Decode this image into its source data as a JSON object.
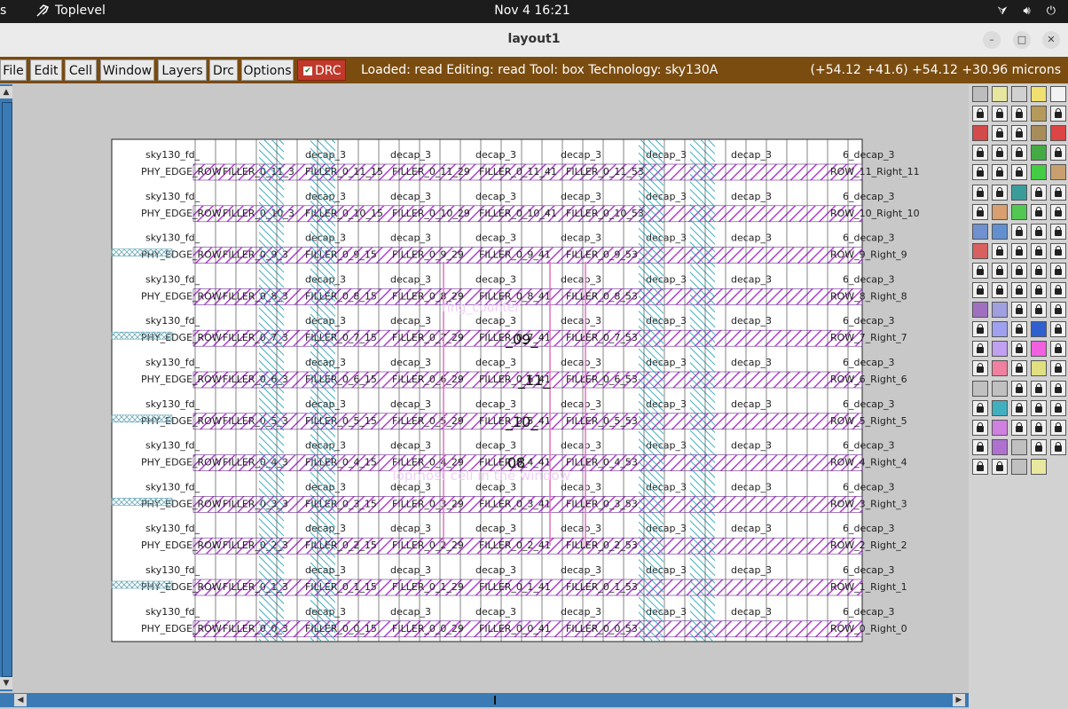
{
  "topbar": {
    "left_fragment": "s",
    "app_name": "Toplevel",
    "clock": "Nov 4  16:21"
  },
  "window": {
    "title": "layout1"
  },
  "menus": [
    "File",
    "Edit",
    "Cell",
    "Window",
    "Layers",
    "Drc",
    "Options"
  ],
  "drc": {
    "label": "DRC",
    "checked": true
  },
  "status": "Loaded: read  Editing: read  Tool: box   Technology: sky130A",
  "coords": "(+54.12 +41.6) +54.12 +30.96 microns",
  "labels": {
    "cell_name": "ring_counter",
    "topmost_message": "Topmost cell in the window",
    "row_prefix": "sky130_fd_",
    "phy_edge": "PHY_EDGE_ROW",
    "decap": "6_decap_3",
    "decap_left": "decap_3",
    "fillers": [
      "FILLER_0_",
      "_15",
      "_29",
      "_41",
      "_53"
    ]
  },
  "rows": [
    {
      "index": "11",
      "right": "ROW_11_Right_11"
    },
    {
      "index": "10",
      "right": "ROW_10_Right_10"
    },
    {
      "index": "9",
      "right": "ROW_9_Right_9"
    },
    {
      "index": "8",
      "right": "ROW_8_Right_8"
    },
    {
      "index": "7",
      "right": "ROW_7_Right_7"
    },
    {
      "index": "6",
      "right": "ROW_6_Right_6"
    },
    {
      "index": "5",
      "right": "ROW_5_Right_5"
    },
    {
      "index": "4",
      "right": "ROW_4_Right_4"
    },
    {
      "index": "3",
      "right": "ROW_3_Right_3"
    },
    {
      "index": "2",
      "right": "ROW_2_Right_2"
    },
    {
      "index": "1",
      "right": "ROW_1_Right_1"
    },
    {
      "index": "0",
      "right": "ROW_0_Right_0"
    }
  ],
  "big_labels": [
    {
      "text": "_09_"
    },
    {
      "text": "_11_"
    },
    {
      "text": "_10_"
    },
    {
      "text": "08"
    }
  ],
  "layer_colors": [
    "#bdbdbd",
    "#e6e6a0",
    "#d0d0d0",
    "#f0e070",
    "#f2f2f2",
    "#f0f0f0",
    "#f0f0f0",
    "#f0f0f0",
    "#b59a5a",
    "#f0f0f0",
    "#d24a4a",
    "#f0f0f0",
    "#f0f0f0",
    "#a88c5a",
    "#d44",
    "#f0f0f0",
    "#f0f0f0",
    "#f0f0f0",
    "#44aa44",
    "#f0f0f0",
    "#f0f0f0",
    "#f0f0f0",
    "#f0f0f0",
    "#44cc44",
    "#c8a070",
    "#f0f0f0",
    "#f0f0f0",
    "#3c9c9c",
    "#f0f0f0",
    "#f0f0f0",
    "#f0f0f0",
    "#d8a070",
    "#52c852",
    "#f0f0f0",
    "#f0f0f0",
    "#7090d0",
    "#6090d0",
    "#f0f0f0",
    "#f0f0f0",
    "#f0f0f0",
    "#d86060",
    "#f0f0f0",
    "#f0f0f0",
    "#f0f0f0",
    "#f0f0f0",
    "#f0f0f0",
    "#f0f0f0",
    "#f0f0f0",
    "#f0f0f0",
    "#f0f0f0",
    "#f0f0f0",
    "#f0f0f0",
    "#f0f0f0",
    "#f0f0f0",
    "#f0f0f0",
    "#a070c0",
    "#a0a0e0",
    "#f0f0f0",
    "#f0f0f0",
    "#f0f0f0",
    "#f0f0f0",
    "#a0a0f0",
    "#f0f0f0",
    "#3060d0",
    "#f0f0f0",
    "#f0f0f0",
    "#c0a0f0",
    "#f0f0f0",
    "#f060e0",
    "#f0f0f0",
    "#f0f0f0",
    "#f080a0",
    "#f0f0f0",
    "#e0e080",
    "#f0f0f0",
    "#c0c0c0",
    "#c0c0c0",
    "#f0f0f0",
    "#f0f0f0",
    "#f0f0f0",
    "#f0f0f0",
    "#40b0c0",
    "#f0f0f0",
    "#f0f0f0",
    "#f0f0f0",
    "#f0f0f0",
    "#d080e0",
    "#f0f0f0",
    "#f0f0f0",
    "#f0f0f0",
    "#f0f0f0",
    "#b070d0",
    "#c0c0c0",
    "#f0f0f0",
    "#f0f0f0",
    "#f0f0f0",
    "#f0f0f0",
    "#c0c0c0",
    "#e8e8a0"
  ]
}
